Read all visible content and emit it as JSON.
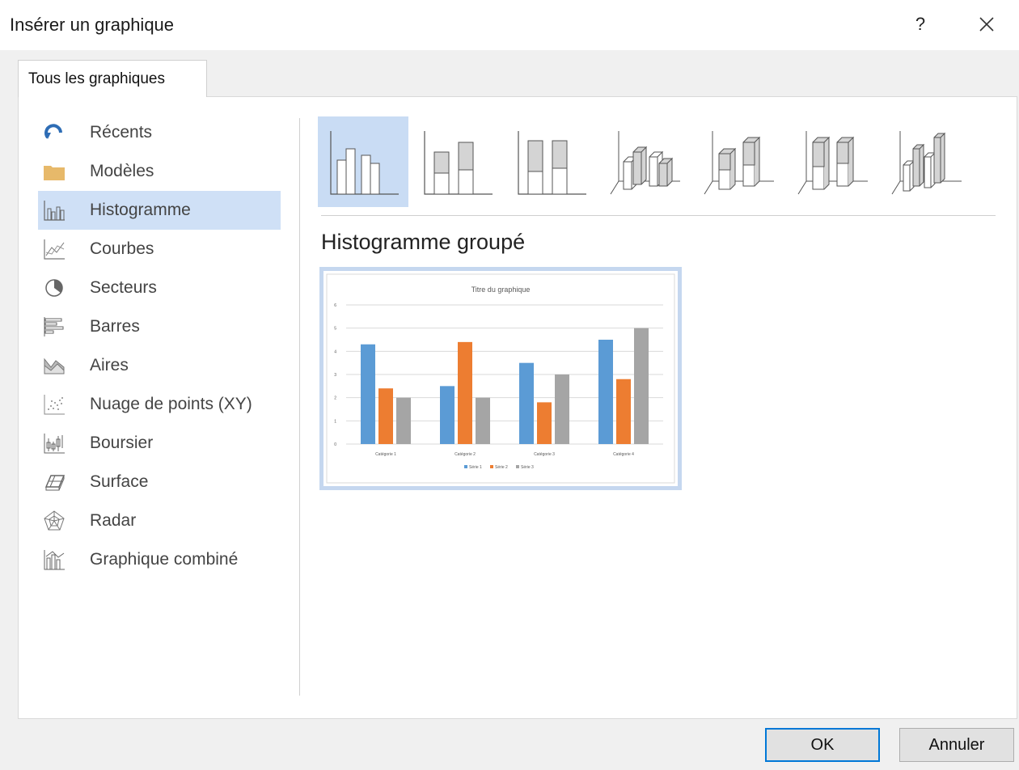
{
  "dialog": {
    "title": "Insérer un graphique",
    "help_label": "?"
  },
  "tabs": [
    {
      "label": "Tous les graphiques"
    }
  ],
  "categories": [
    {
      "label": "Récents",
      "icon": "recent-icon"
    },
    {
      "label": "Modèles",
      "icon": "folder-icon"
    },
    {
      "label": "Histogramme",
      "icon": "column-chart-icon",
      "selected": true
    },
    {
      "label": "Courbes",
      "icon": "line-chart-icon"
    },
    {
      "label": "Secteurs",
      "icon": "pie-chart-icon"
    },
    {
      "label": "Barres",
      "icon": "bar-chart-icon"
    },
    {
      "label": "Aires",
      "icon": "area-chart-icon"
    },
    {
      "label": "Nuage de points (XY)",
      "icon": "scatter-chart-icon"
    },
    {
      "label": "Boursier",
      "icon": "stock-chart-icon"
    },
    {
      "label": "Surface",
      "icon": "surface-chart-icon"
    },
    {
      "label": "Radar",
      "icon": "radar-chart-icon"
    },
    {
      "label": "Graphique combiné",
      "icon": "combo-chart-icon"
    }
  ],
  "chart_subtypes": [
    {
      "icon": "clustered-column-icon",
      "selected": true
    },
    {
      "icon": "stacked-column-icon"
    },
    {
      "icon": "stacked-100-column-icon"
    },
    {
      "icon": "3d-clustered-column-icon"
    },
    {
      "icon": "3d-stacked-column-icon"
    },
    {
      "icon": "3d-stacked-100-column-icon"
    },
    {
      "icon": "3d-column-icon"
    }
  ],
  "selected_subtype_title": "Histogramme groupé",
  "colors": {
    "selection": "#cfe0f6",
    "series_1": "#5b9bd5",
    "series_2": "#ed7d31",
    "series_3": "#a5a5a5"
  },
  "chart_data": {
    "type": "bar",
    "title": "Titre du graphique",
    "categories": [
      "Catégorie 1",
      "Catégorie 2",
      "Catégorie 3",
      "Catégorie 4"
    ],
    "series": [
      {
        "name": "Série 1",
        "values": [
          4.3,
          2.5,
          3.5,
          4.5
        ],
        "color": "#5b9bd5"
      },
      {
        "name": "Série 2",
        "values": [
          2.4,
          4.4,
          1.8,
          2.8
        ],
        "color": "#ed7d31"
      },
      {
        "name": "Série 3",
        "values": [
          2,
          2,
          3,
          5
        ],
        "color": "#a5a5a5"
      }
    ],
    "y_ticks": [
      "0",
      "1",
      "2",
      "3",
      "4",
      "5",
      "6"
    ],
    "ylim": [
      0,
      6
    ],
    "grid": true,
    "legend": "bottom"
  },
  "buttons": {
    "ok": "OK",
    "cancel": "Annuler"
  }
}
